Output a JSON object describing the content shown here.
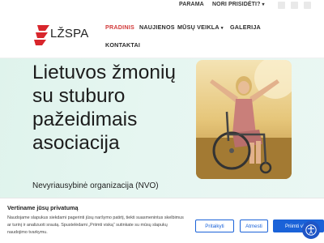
{
  "topbar": {
    "links": [
      {
        "label": "PARAMA"
      },
      {
        "label": "NORI PRISIDĖTI?"
      }
    ],
    "social_icons": [
      "facebook-icon",
      "instagram-icon",
      "youtube-icon"
    ]
  },
  "header": {
    "logo_text": "LŽSPA",
    "nav": [
      {
        "label": "PRADINIS",
        "active": true
      },
      {
        "label": "NAUJIENOS"
      },
      {
        "label": "MŪSŲ VEIKLA"
      },
      {
        "label": "GALERIJA"
      },
      {
        "label": "KONTAKTAI"
      }
    ]
  },
  "hero": {
    "title": "Lietuvos žmonių su stuburo pažeidimais asociacija",
    "subtitle": "Nevyriausybinė organizacija (NVO)"
  },
  "cookie": {
    "title": "Vertiname jūsų privatumą",
    "text": "Naudojame slapukus siekdami pagerinti jūsų naršymo patirtį, tiekti suasmenintus skelbimus ar turinį ir analizuoti srautą. Spustelėdami „Priimti viską“ sutinkate su mūsų slapukų naudojimo tvarkymu.",
    "buttons": {
      "customize": "Pritaikyti",
      "reject": "Atmesti",
      "accept": "Priimti viską"
    }
  },
  "colors": {
    "accent": "#d23b3b",
    "button_blue": "#1a62d8",
    "hero_bg": "#e3f5ef",
    "a11y_blue": "#1f55c6"
  }
}
